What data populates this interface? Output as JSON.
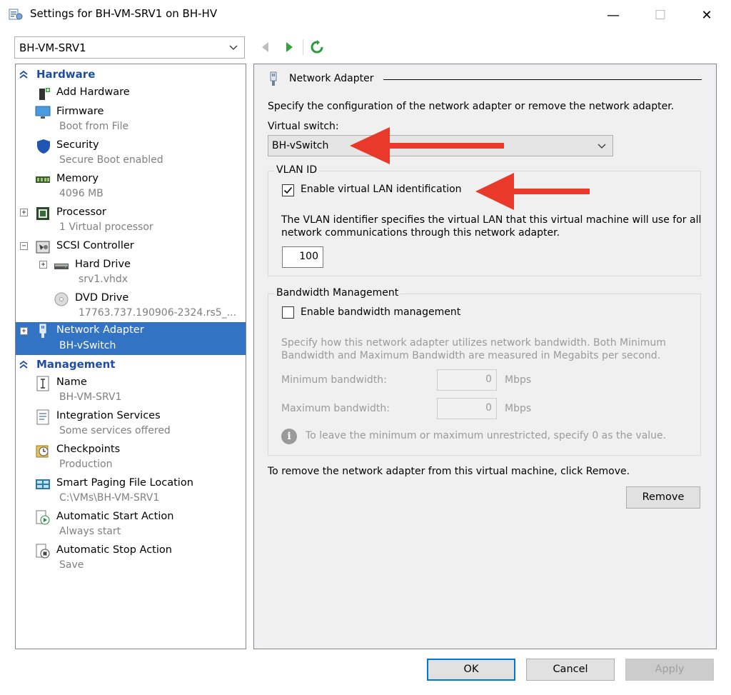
{
  "window": {
    "title": "Settings for BH-VM-SRV1 on BH-HV",
    "controls": {
      "minimize": "—",
      "maximize": "☐",
      "close": "✕"
    }
  },
  "toolbar": {
    "vm_select_value": "BH-VM-SRV1"
  },
  "tree": {
    "hardware_header": "Hardware",
    "management_header": "Management",
    "items": [
      {
        "name": "Add Hardware",
        "sub": ""
      },
      {
        "name": "Firmware",
        "sub": "Boot from File"
      },
      {
        "name": "Security",
        "sub": "Secure Boot enabled"
      },
      {
        "name": "Memory",
        "sub": "4096 MB"
      },
      {
        "name": "Processor",
        "sub": "1 Virtual processor"
      },
      {
        "name": "SCSI Controller",
        "sub": ""
      },
      {
        "name": "Hard Drive",
        "sub": "srv1.vhdx"
      },
      {
        "name": "DVD Drive",
        "sub": "17763.737.190906-2324.rs5_..."
      },
      {
        "name": "Network Adapter",
        "sub": "BH-vSwitch"
      },
      {
        "name": "Name",
        "sub": "BH-VM-SRV1"
      },
      {
        "name": "Integration Services",
        "sub": "Some services offered"
      },
      {
        "name": "Checkpoints",
        "sub": "Production"
      },
      {
        "name": "Smart Paging File Location",
        "sub": "C:\\VMs\\BH-VM-SRV1"
      },
      {
        "name": "Automatic Start Action",
        "sub": "Always start"
      },
      {
        "name": "Automatic Stop Action",
        "sub": "Save"
      }
    ],
    "selected": "Network Adapter"
  },
  "details": {
    "section_title": "Network Adapter",
    "intro": "Specify the configuration of the network adapter or remove the network adapter.",
    "virtual_switch_label": "Virtual switch:",
    "virtual_switch_value": "BH-vSwitch",
    "vlan": {
      "group_label": "VLAN ID",
      "checkbox_label": "Enable virtual LAN identification",
      "checked": true,
      "desc_line1": "The VLAN identifier specifies the virtual LAN that this virtual machine will use for all",
      "desc_line2": "network communications through this network adapter.",
      "value": "100"
    },
    "bandwidth": {
      "group_label": "Bandwidth Management",
      "checkbox_label": "Enable bandwidth management",
      "checked": false,
      "desc_line1": "Specify how this network adapter utilizes network bandwidth. Both Minimum",
      "desc_line2": "Bandwidth and Maximum Bandwidth are measured in Megabits per second.",
      "min_label": "Minimum bandwidth:",
      "min_value": "0",
      "max_label": "Maximum bandwidth:",
      "max_value": "0",
      "unit": "Mbps",
      "info_text": "To leave the minimum or maximum unrestricted, specify 0 as the value."
    },
    "remove_text": "To remove the network adapter from this virtual machine, click Remove.",
    "remove_button": "Remove"
  },
  "footer": {
    "ok": "OK",
    "cancel": "Cancel",
    "apply": "Apply"
  },
  "colors": {
    "selection": "#3373c4",
    "section_header": "#1f4ea1",
    "annotation_arrow": "#e8392b",
    "default_button_border": "#0078d7"
  }
}
